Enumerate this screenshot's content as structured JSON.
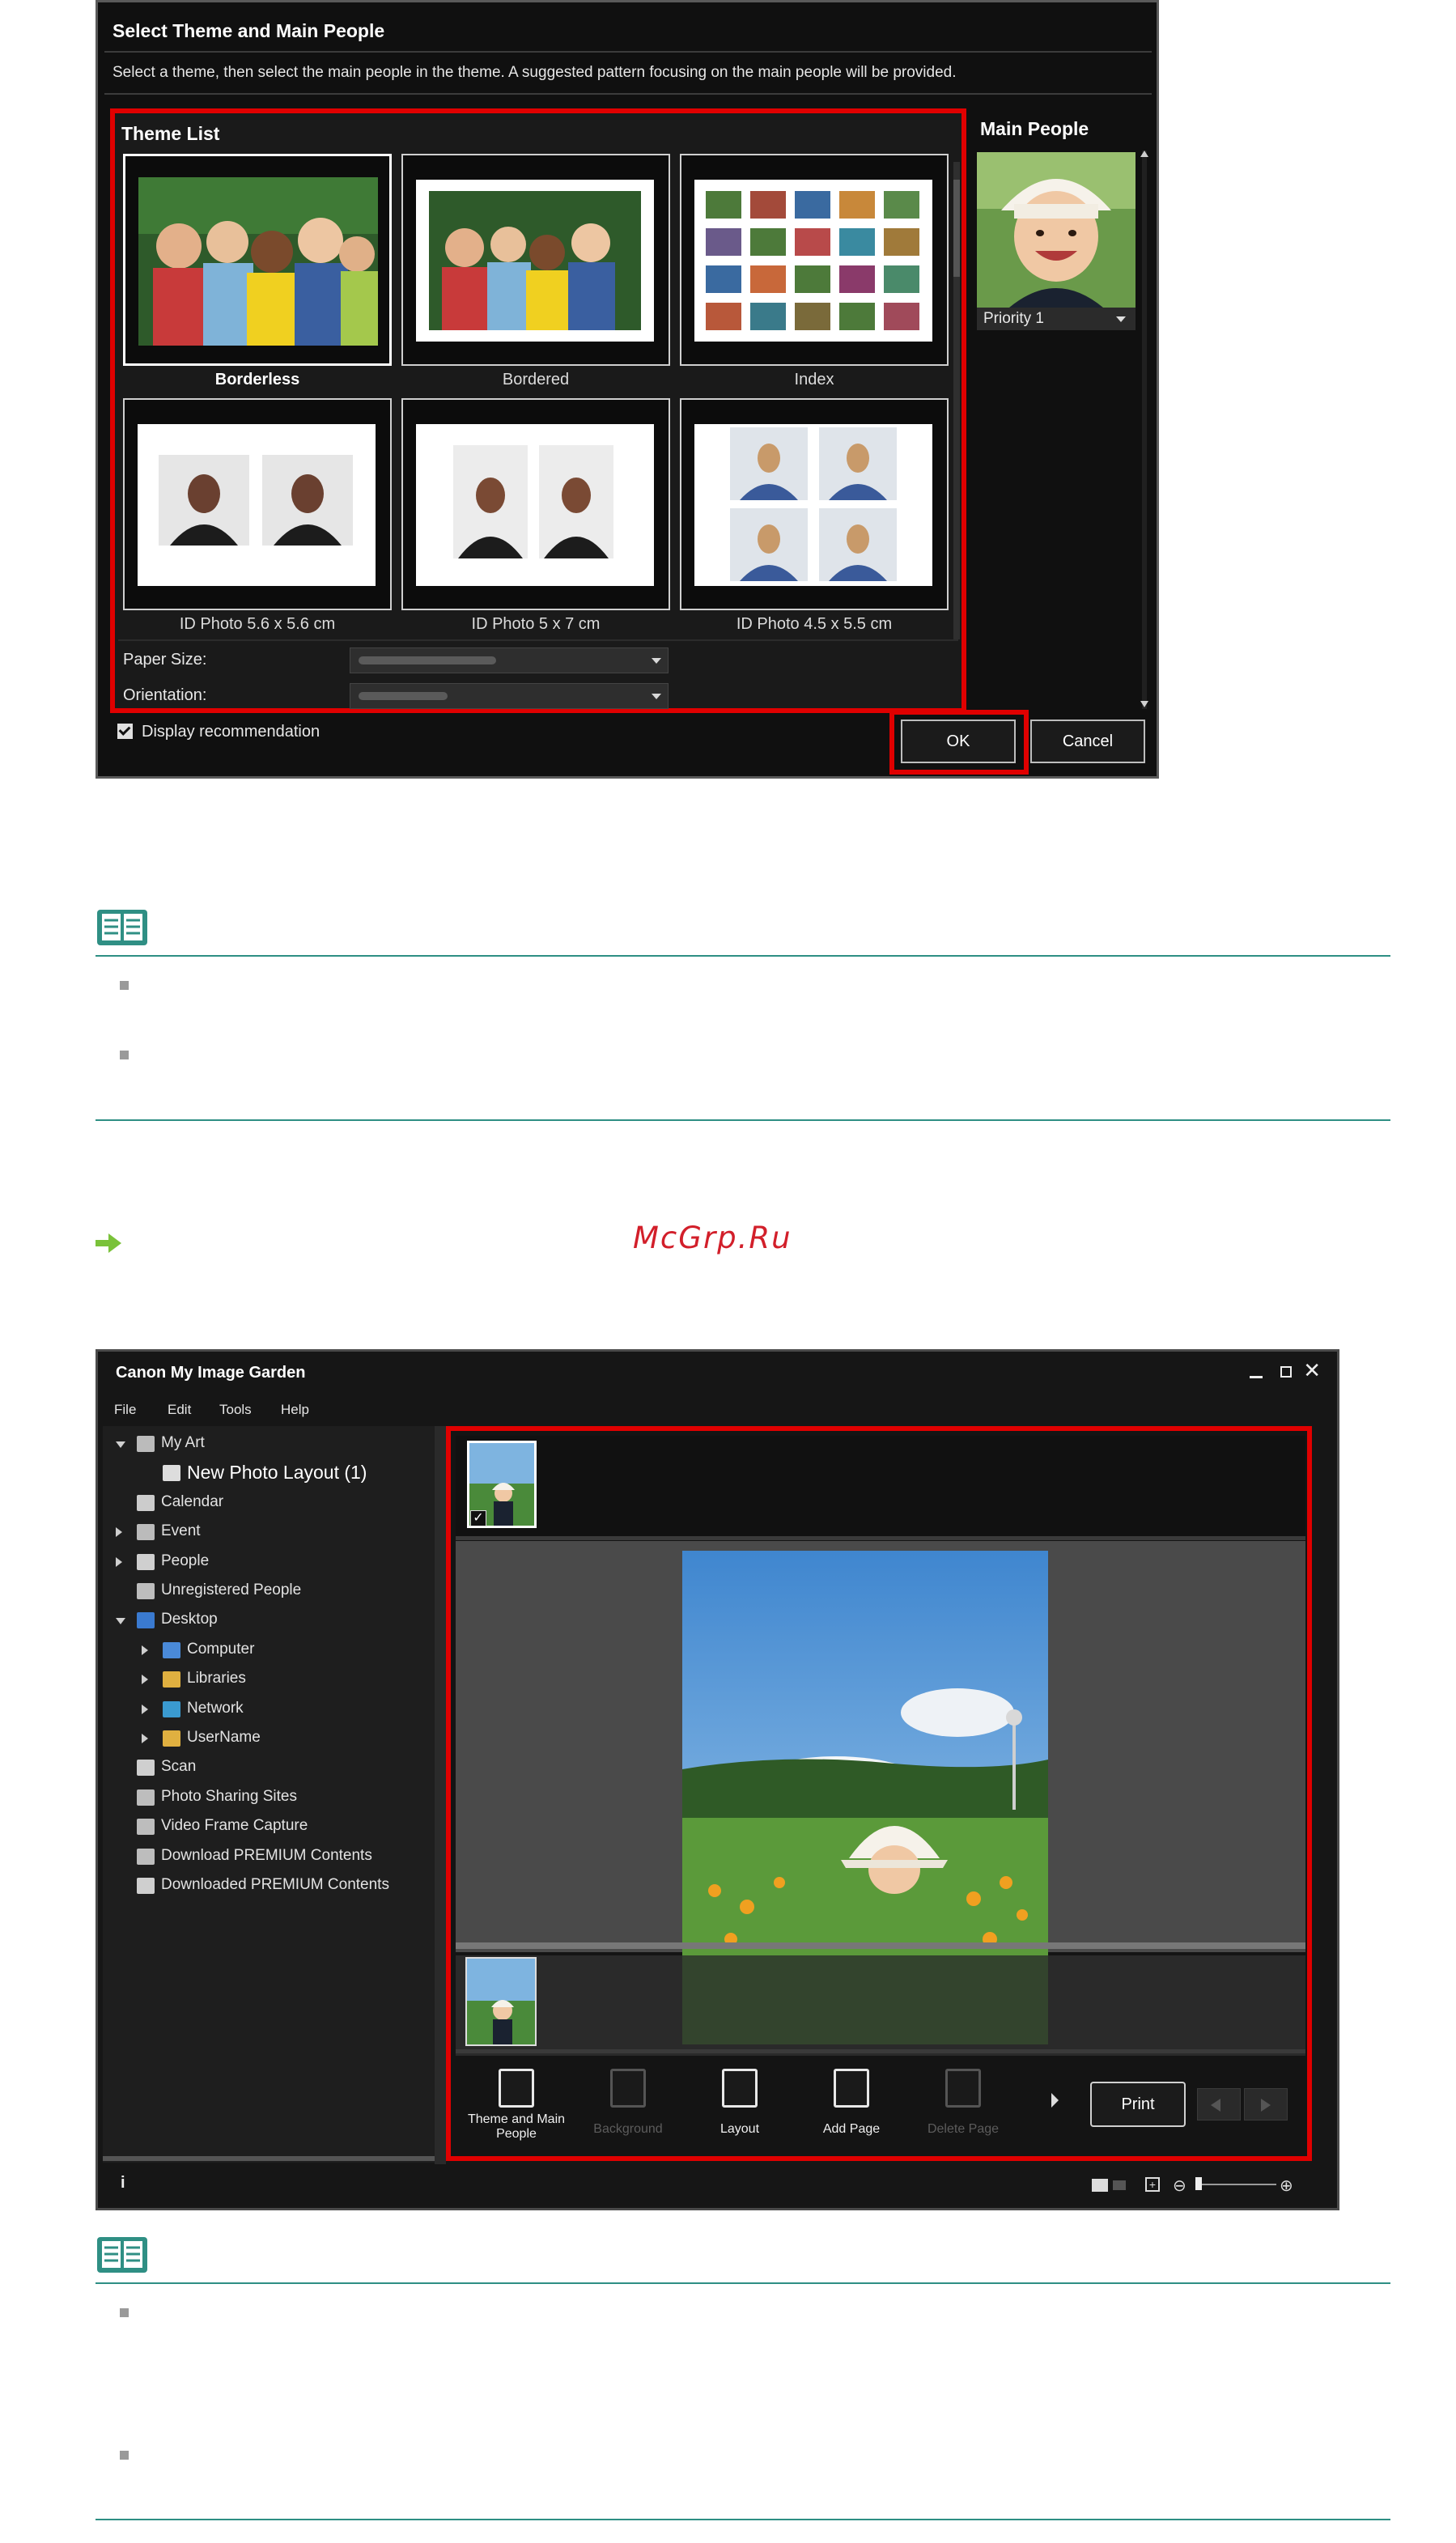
{
  "dialog": {
    "title": "Select Theme and Main People",
    "instruction": "Select a theme, then select the main people in the theme. A suggested pattern focusing on the main people will be provided.",
    "theme_list_title": "Theme List",
    "main_people_title": "Main People",
    "themes": [
      {
        "label": "Borderless",
        "selected": true
      },
      {
        "label": "Bordered",
        "selected": false
      },
      {
        "label": "Index",
        "selected": false
      },
      {
        "label": "ID Photo 5.6 x 5.6 cm",
        "selected": false
      },
      {
        "label": "ID Photo 5 x 7 cm",
        "selected": false
      },
      {
        "label": "ID Photo 4.5 x 5.5 cm",
        "selected": false
      }
    ],
    "paper_size_label": "Paper Size:",
    "orientation_label": "Orientation:",
    "priority_value": "Priority 1",
    "display_recommendation_label": "Display recommendation",
    "display_recommendation_checked": true,
    "ok_label": "OK",
    "cancel_label": "Cancel"
  },
  "watermark": "McGrp.Ru",
  "app": {
    "title": "Canon My Image Garden",
    "menu": [
      "File",
      "Edit",
      "Tools",
      "Help"
    ],
    "tree": [
      {
        "label": "My Art",
        "level": 0,
        "toggle": "down",
        "icon": "myart-icon"
      },
      {
        "label": "New Photo Layout (1)",
        "level": 1,
        "toggle": "none",
        "icon": "layout-icon",
        "selected": true
      },
      {
        "label": "Calendar",
        "level": 0,
        "toggle": "none",
        "icon": "calendar-icon"
      },
      {
        "label": "Event",
        "level": 0,
        "toggle": "right",
        "icon": "event-icon"
      },
      {
        "label": "People",
        "level": 0,
        "toggle": "right",
        "icon": "person-icon"
      },
      {
        "label": "Unregistered People",
        "level": 0,
        "toggle": "none",
        "icon": "unknown-person-icon"
      },
      {
        "label": "Desktop",
        "level": 0,
        "toggle": "down",
        "icon": "desktop-icon"
      },
      {
        "label": "Computer",
        "level": 1,
        "toggle": "right",
        "icon": "computer-icon"
      },
      {
        "label": "Libraries",
        "level": 1,
        "toggle": "right",
        "icon": "libraries-icon"
      },
      {
        "label": "Network",
        "level": 1,
        "toggle": "right",
        "icon": "network-icon"
      },
      {
        "label": "UserName",
        "level": 1,
        "toggle": "right",
        "icon": "user-folder-icon"
      },
      {
        "label": "Scan",
        "level": 0,
        "toggle": "none",
        "icon": "scan-icon"
      },
      {
        "label": "Photo Sharing Sites",
        "level": 0,
        "toggle": "none",
        "icon": "sharing-icon"
      },
      {
        "label": "Video Frame Capture",
        "level": 0,
        "toggle": "none",
        "icon": "video-icon"
      },
      {
        "label": "Download PREMIUM Contents",
        "level": 0,
        "toggle": "none",
        "icon": "download-icon"
      },
      {
        "label": "Downloaded PREMIUM Contents",
        "level": 0,
        "toggle": "none",
        "icon": "folder-icon"
      }
    ],
    "tools": [
      {
        "label": "Theme and Main People",
        "enabled": true
      },
      {
        "label": "Background",
        "enabled": false
      },
      {
        "label": "Layout",
        "enabled": true
      },
      {
        "label": "Add Page",
        "enabled": true
      },
      {
        "label": "Delete Page",
        "enabled": false
      }
    ],
    "print_label": "Print",
    "info_label": "i"
  }
}
